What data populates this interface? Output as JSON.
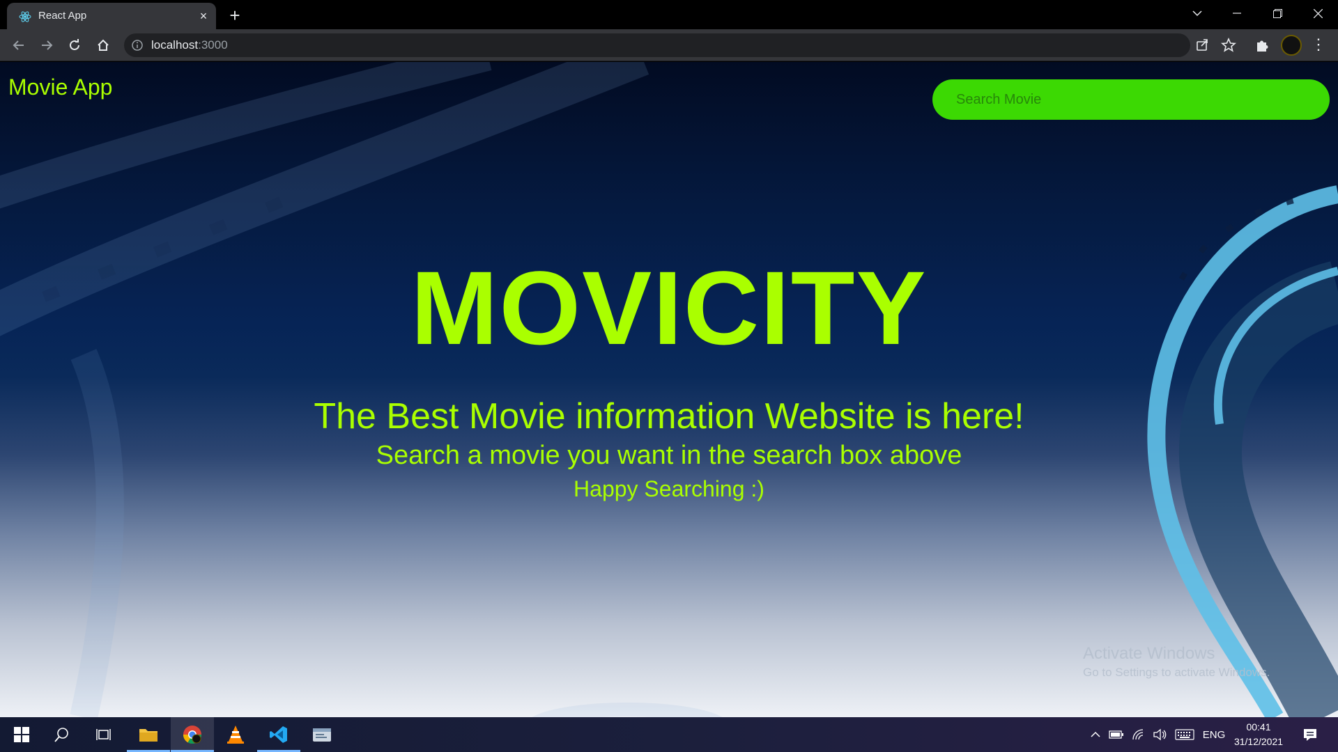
{
  "browser": {
    "tab_title": "React App",
    "tab_close": "×",
    "new_tab": "+",
    "url_host": "localhost",
    "url_port": ":3000",
    "icons": [
      "react-favicon",
      "info-icon",
      "share-icon",
      "star-icon",
      "puzzle-icon",
      "profile-avatar",
      "kebab-menu-icon"
    ]
  },
  "page": {
    "brand": "Movie App",
    "search_placeholder": "Search Movie",
    "hero_title": "MOVICITY",
    "hero_subtitle": "The Best Movie information Website is here!",
    "hero_line": "Search a movie you want in the search box above",
    "hero_happy": "Happy Searching :)",
    "accent_color": "#aaff00",
    "search_color": "#3cd903"
  },
  "watermark": {
    "title": "Activate Windows",
    "subtitle": "Go to Settings to activate Windows."
  },
  "taskbar": {
    "language": "ENG",
    "time": "00:41",
    "date": "31/12/2021"
  }
}
